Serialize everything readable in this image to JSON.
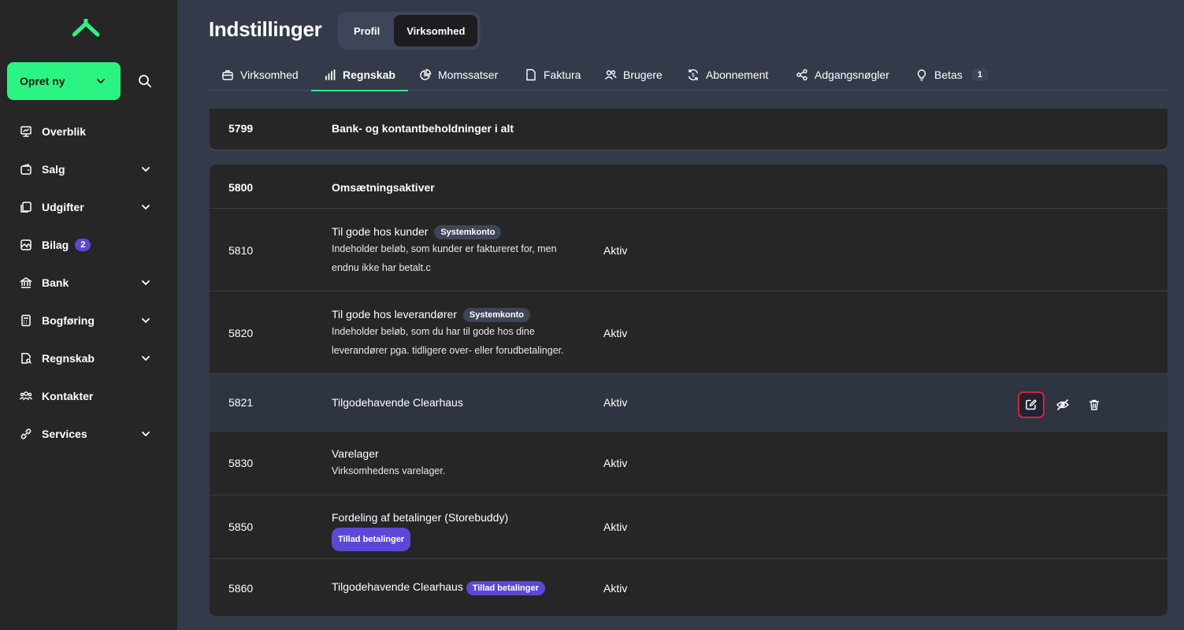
{
  "sidebar": {
    "create_label": "Opret ny",
    "items": [
      {
        "label": "Overblik",
        "icon": "presentation-chart-icon",
        "chevron": false
      },
      {
        "label": "Salg",
        "icon": "wallet-icon",
        "chevron": true
      },
      {
        "label": "Udgifter",
        "icon": "receipt-copy-icon",
        "chevron": true
      },
      {
        "label": "Bilag",
        "icon": "image-document-icon",
        "chevron": false,
        "badge": "2"
      },
      {
        "label": "Bank",
        "icon": "bank-icon",
        "chevron": true
      },
      {
        "label": "Bogføring",
        "icon": "calculator-icon",
        "chevron": true
      },
      {
        "label": "Regnskab",
        "icon": "report-search-icon",
        "chevron": true
      },
      {
        "label": "Kontakter",
        "icon": "people-icon",
        "chevron": false
      },
      {
        "label": "Services",
        "icon": "link-icon",
        "chevron": true
      }
    ]
  },
  "header": {
    "title": "Indstillinger",
    "segments": [
      "Profil",
      "Virksomhed"
    ],
    "active_segment": "Virksomhed"
  },
  "tabs": {
    "items": [
      "Virksomhed",
      "Regnskab",
      "Momssatser",
      "Faktura",
      "Brugere",
      "Abonnement",
      "Adgangsnøgler",
      "Betas"
    ],
    "betas_badge": "1",
    "active": "Regnskab"
  },
  "table": {
    "top_row": {
      "number": "5799",
      "name": "Bank- og kontantbeholdninger i alt"
    },
    "group_header": {
      "number": "5800",
      "name": "Omsætningsaktiver"
    },
    "rows": [
      {
        "number": "5810",
        "name": "Til gode hos kunder",
        "tag": "Systemkonto",
        "desc_line1": "Indeholder beløb, som kunder er faktureret for, men",
        "desc_line2": "endnu ikke har betalt.c",
        "type": "Aktiv"
      },
      {
        "number": "5820",
        "name": "Til gode hos leverandører",
        "tag": "Systemkonto",
        "desc_line1": "Indeholder beløb, som du har til gode hos dine",
        "desc_line2": "leverandører pga. tidligere over- eller forudbetalinger.",
        "type": "Aktiv"
      },
      {
        "number": "5821",
        "name": "Tilgodehavende Clearhaus",
        "type": "Aktiv"
      },
      {
        "number": "5830",
        "name": "Varelager",
        "desc_line1": "Virksomhedens varelager.",
        "type": "Aktiv"
      },
      {
        "number": "5850",
        "name": "Fordeling af betalinger (Storebuddy)",
        "tag": "Tillad betalinger",
        "type": "Aktiv"
      },
      {
        "number": "5860",
        "name": "Tilgodehavende Clearhaus",
        "tag": "Tillad betalinger",
        "type": "Aktiv"
      }
    ]
  },
  "colors": {
    "accent": "#2bf482",
    "purple_tag": "#5b48d6",
    "focus_ring": "#d02537"
  }
}
